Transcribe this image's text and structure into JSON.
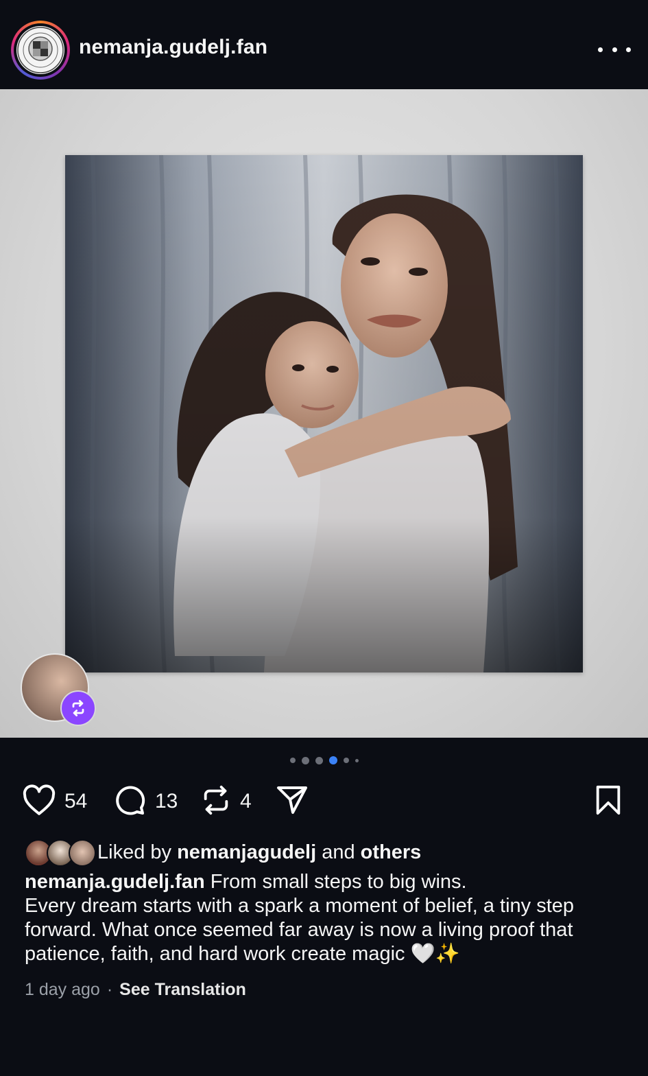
{
  "header": {
    "username": "nemanja.gudelj.fan",
    "avatar_logo_text": "NONDUS",
    "more_icon": "more-horizontal-icon"
  },
  "media": {
    "carousel_total": 6,
    "carousel_active_index": 3,
    "repost_icon": "repost-icon"
  },
  "actions": {
    "likes": "54",
    "comments": "13",
    "reposts": "4",
    "like_icon": "heart-icon",
    "comment_icon": "comment-icon",
    "repost_icon": "repost-icon",
    "share_icon": "send-icon",
    "save_icon": "bookmark-icon"
  },
  "liked_by": {
    "prefix": "Liked by",
    "user": "nemanjagudelj",
    "conjunction": "and",
    "others": "others"
  },
  "caption": {
    "username": "nemanja.gudelj.fan",
    "first_line": "From small steps to big wins.",
    "body": "Every dream starts with a spark a moment of belief, a tiny step forward. What once seemed far away is now a living proof that patience, faith, and hard work create magic 🤍✨"
  },
  "meta": {
    "time": "1 day ago",
    "separator": "·",
    "translation_link": "See Translation"
  },
  "colors": {
    "background": "#0b0d14",
    "accent_blue": "#3b82f6",
    "repost_badge": "#8b46ff"
  }
}
